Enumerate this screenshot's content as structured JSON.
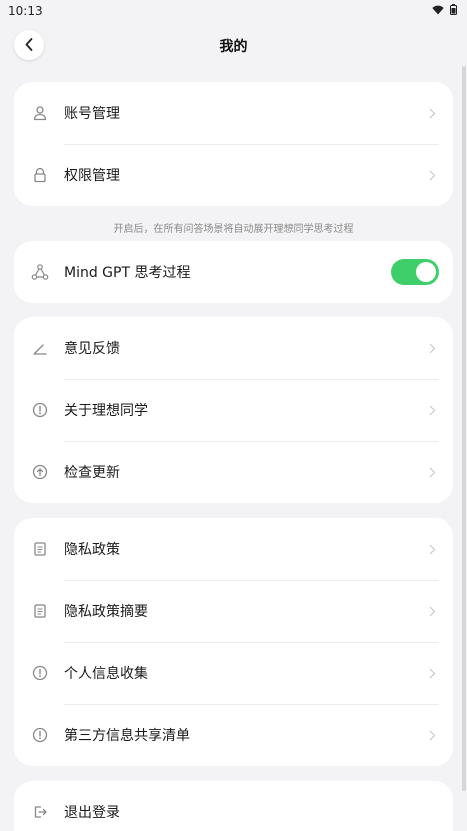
{
  "status_bar": {
    "time": "10:13",
    "icons": [
      "wifi-icon",
      "battery-icon"
    ]
  },
  "header": {
    "title": "我的",
    "back_icon": "chevron-left-icon"
  },
  "account_card": {
    "items": [
      {
        "label": "账号管理",
        "icon": "user-icon"
      },
      {
        "label": "权限管理",
        "icon": "lock-icon"
      }
    ]
  },
  "hint": "开启后，在所有问答场景将自动展开理想同学思考过程",
  "mindgpt_card": {
    "label": "Mind GPT 思考过程",
    "icon": "nodes-icon",
    "toggle_on": true,
    "toggle_color": "#3fcf6a"
  },
  "about_card": {
    "items": [
      {
        "label": "意见反馈",
        "icon": "pen-icon"
      },
      {
        "label": "关于理想同学",
        "icon": "info-icon"
      },
      {
        "label": "检查更新",
        "icon": "upload-icon"
      }
    ]
  },
  "privacy_card": {
    "items": [
      {
        "label": "隐私政策",
        "icon": "doc-icon"
      },
      {
        "label": "隐私政策摘要",
        "icon": "doc-icon"
      },
      {
        "label": "个人信息收集",
        "icon": "info-icon"
      },
      {
        "label": "第三方信息共享清单",
        "icon": "info-icon"
      }
    ]
  },
  "logout_card": {
    "label": "退出登录",
    "icon": "logout-icon"
  }
}
